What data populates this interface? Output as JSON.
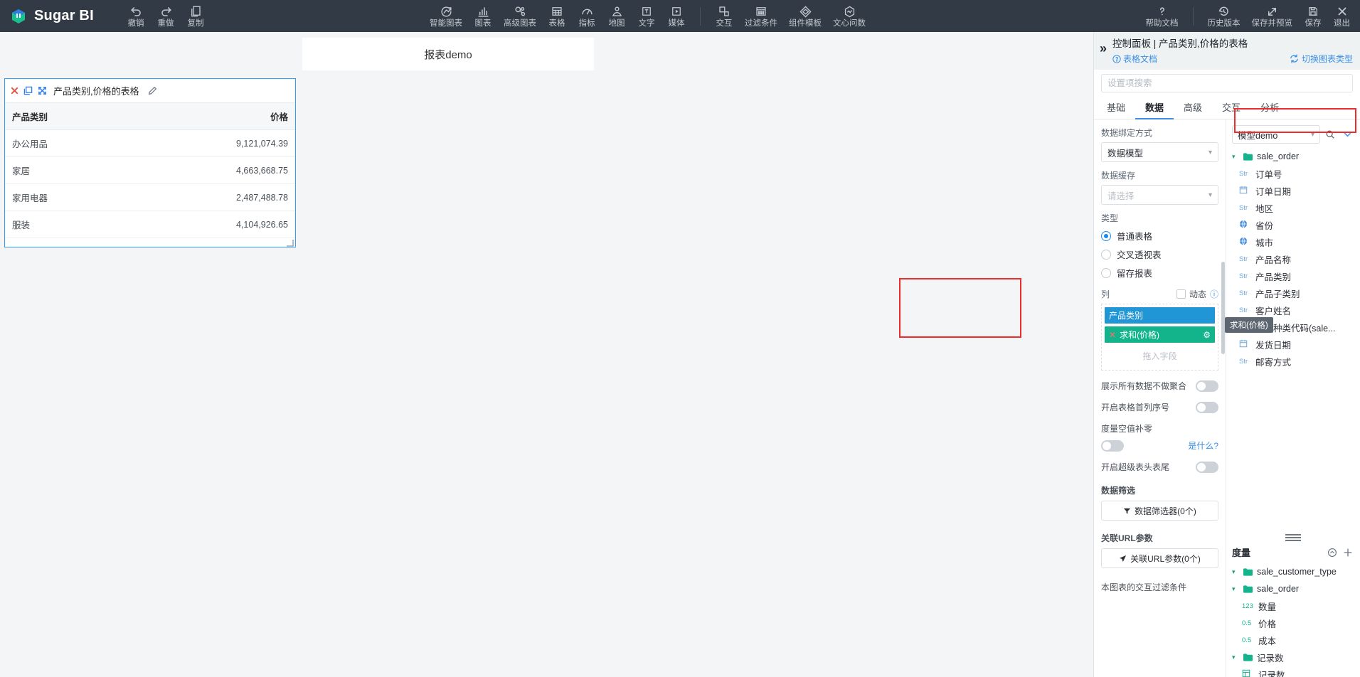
{
  "app": {
    "brand": "Sugar BI"
  },
  "toolbar": {
    "history": [
      {
        "label": "撤销",
        "icon": "undo-icon"
      },
      {
        "label": "重做",
        "icon": "redo-icon"
      },
      {
        "label": "复制",
        "icon": "copy-icon"
      }
    ],
    "insert": [
      {
        "label": "智能图表",
        "icon": "smart-chart-icon"
      },
      {
        "label": "图表",
        "icon": "bar-chart-icon"
      },
      {
        "label": "高级图表",
        "icon": "advanced-chart-icon"
      },
      {
        "label": "表格",
        "icon": "table-icon"
      },
      {
        "label": "指标",
        "icon": "gauge-icon"
      },
      {
        "label": "地图",
        "icon": "map-pin-icon"
      },
      {
        "label": "文字",
        "icon": "text-icon"
      },
      {
        "label": "媒体",
        "icon": "media-icon"
      }
    ],
    "tools": [
      {
        "label": "交互",
        "icon": "interaction-icon"
      },
      {
        "label": "过滤条件",
        "icon": "filter-condition-icon"
      },
      {
        "label": "组件模板",
        "icon": "component-template-icon"
      },
      {
        "label": "文心问数",
        "icon": "ai-ask-icon"
      }
    ],
    "right": [
      {
        "label": "帮助文档",
        "icon": "question-icon"
      },
      {
        "label": "历史版本",
        "icon": "history-icon"
      },
      {
        "label": "保存并预览",
        "icon": "expand-arrows-icon"
      },
      {
        "label": "保存",
        "icon": "save-icon"
      },
      {
        "label": "退出",
        "icon": "close-icon"
      }
    ]
  },
  "canvas": {
    "report_title": "报表demo",
    "widget": {
      "title": "产品类别,价格的表格",
      "actions": [
        {
          "name": "delete-widget-icon",
          "glyph": "✕"
        },
        {
          "name": "duplicate-widget-icon",
          "glyph": "❐"
        },
        {
          "name": "fullscreen-widget-icon",
          "glyph": "✥"
        }
      ],
      "edit_icon": "pencil-icon",
      "table": {
        "columns": [
          "产品类别",
          "价格"
        ],
        "rows": [
          {
            "category": "办公用品",
            "price": "9,121,074.39"
          },
          {
            "category": "家居",
            "price": "4,663,668.75"
          },
          {
            "category": "家用电器",
            "price": "2,487,488.78"
          },
          {
            "category": "服装",
            "price": "4,104,926.65"
          }
        ]
      }
    }
  },
  "panel": {
    "collapse_icon": "chevron-double-right-icon",
    "title": "控制面板 | 产品类别,价格的表格",
    "doc_link": "表格文档",
    "switch_chart": "切换图表类型",
    "search_placeholder": "设置项搜索",
    "search_value": "",
    "tabs": [
      {
        "label": "基础",
        "active": false
      },
      {
        "label": "数据",
        "active": true
      },
      {
        "label": "高级",
        "active": false
      },
      {
        "label": "交互",
        "active": false
      },
      {
        "label": "分析",
        "active": false
      }
    ],
    "settings": {
      "binding_label": "数据绑定方式",
      "binding_value": "数据模型",
      "cache_label": "数据缓存",
      "cache_placeholder": "请选择",
      "type_label": "类型",
      "type_options": [
        {
          "label": "普通表格",
          "selected": true
        },
        {
          "label": "交叉透视表",
          "selected": false
        },
        {
          "label": "留存报表",
          "selected": false
        }
      ],
      "columns_label": "列",
      "dynamic_label": "动态",
      "chips": [
        {
          "label": "产品类别",
          "kind": "dimension"
        },
        {
          "label": "求和(价格)",
          "kind": "measure"
        }
      ],
      "drop_hint": "拖入字段",
      "chip_tooltip": "求和(价格)",
      "toggles": [
        {
          "label": "展示所有数据不做聚合",
          "on": false
        },
        {
          "label": "开启表格首列序号",
          "on": false
        }
      ],
      "null_fill_label": "度量空值补零",
      "null_fill_on": false,
      "null_fill_link": "是什么?",
      "super_header_label": "开启超级表头表尾",
      "super_header_on": false,
      "filter_section": "数据筛选",
      "filter_button": "数据筛选器(0个)",
      "url_section": "关联URL参数",
      "url_button": "关联URL参数(0个)",
      "interaction_note": "本图表的交互过滤条件"
    },
    "fields": {
      "model_value": "模型demo",
      "search_icon": "search-icon",
      "expand_icon": "chevron-down-icon",
      "dimension_tree": [
        {
          "type": "folder",
          "label": "sale_order",
          "depth": 0
        },
        {
          "type": "field",
          "ftype": "Str",
          "label": "订单号",
          "depth": 1
        },
        {
          "type": "field",
          "ftype": "date",
          "label": "订单日期",
          "depth": 1
        },
        {
          "type": "field",
          "ftype": "Str",
          "label": "地区",
          "depth": 1
        },
        {
          "type": "field",
          "ftype": "geo",
          "label": "省份",
          "depth": 1
        },
        {
          "type": "field",
          "ftype": "geo",
          "label": "城市",
          "depth": 1
        },
        {
          "type": "field",
          "ftype": "Str",
          "label": "产品名称",
          "depth": 1
        },
        {
          "type": "field",
          "ftype": "Str",
          "label": "产品类别",
          "depth": 1
        },
        {
          "type": "field",
          "ftype": "Str",
          "label": "产品子类别",
          "depth": 1
        },
        {
          "type": "field",
          "ftype": "Str",
          "label": "客户姓名",
          "depth": 1
        },
        {
          "type": "field",
          "ftype": "Str",
          "label": "客户种类代码(sale...",
          "depth": 1
        },
        {
          "type": "field",
          "ftype": "date",
          "label": "发货日期",
          "depth": 1
        },
        {
          "type": "field",
          "ftype": "Str",
          "label": "邮寄方式",
          "depth": 1
        }
      ],
      "measure_header": "度量",
      "measure_icons": [
        "refresh-measure-icon",
        "add-measure-icon"
      ],
      "measure_tree": [
        {
          "type": "folder",
          "label": "sale_customer_type",
          "depth": 0
        },
        {
          "type": "folder",
          "label": "sale_order",
          "depth": 0
        },
        {
          "type": "field",
          "ftype": "123",
          "label": "数量",
          "depth": 1
        },
        {
          "type": "field",
          "ftype": "0.5",
          "label": "价格",
          "depth": 1
        },
        {
          "type": "field",
          "ftype": "0.5",
          "label": "成本",
          "depth": 1
        },
        {
          "type": "folder",
          "label": "记录数",
          "depth": 0
        },
        {
          "type": "field",
          "ftype": "cnt",
          "label": "记录数",
          "depth": 1
        }
      ]
    }
  },
  "colors": {
    "topbar": "#323a45",
    "accent": "#3a8ee6",
    "dimension_chip": "#2196d6",
    "measure_chip": "#13b48c",
    "highlight_box": "#f02b2b",
    "widget_border": "#2f9ef5"
  }
}
